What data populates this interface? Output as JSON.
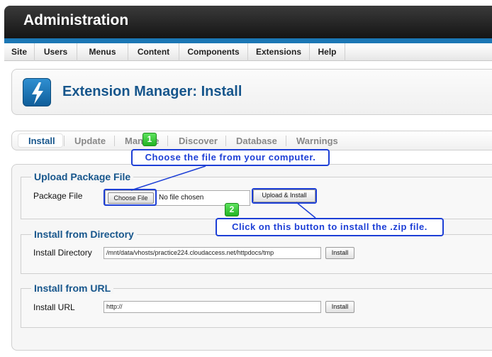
{
  "header": {
    "title": "Administration"
  },
  "menu": {
    "items": [
      {
        "label": "Site"
      },
      {
        "label": "Users"
      },
      {
        "label": "Menus"
      },
      {
        "label": "Content"
      },
      {
        "label": "Components"
      },
      {
        "label": "Extensions"
      },
      {
        "label": "Help"
      }
    ]
  },
  "page": {
    "title": "Extension Manager: Install",
    "icon": "lightning-bolt-icon"
  },
  "tabs": [
    {
      "label": "Install",
      "active": true
    },
    {
      "label": "Update"
    },
    {
      "label": "Manage"
    },
    {
      "label": "Discover"
    },
    {
      "label": "Database"
    },
    {
      "label": "Warnings"
    }
  ],
  "upload": {
    "legend": "Upload Package File",
    "field_label": "Package File",
    "choose_label": "Choose File",
    "no_file_text": "No file chosen",
    "button_label": "Upload & Install"
  },
  "directory": {
    "legend": "Install from Directory",
    "field_label": "Install Directory",
    "value": "/mnt/data/vhosts/practice224.cloudaccess.net/httpdocs/tmp",
    "button_label": "Install"
  },
  "url": {
    "legend": "Install from URL",
    "field_label": "Install URL",
    "value": "http://",
    "button_label": "Install"
  },
  "annotations": [
    {
      "number": "1",
      "text": "Choose the file from your computer."
    },
    {
      "number": "2",
      "text": "Click on this button to install the .zip file."
    }
  ],
  "colors": {
    "accent": "#17568c",
    "callout": "#1d3fd6",
    "badge": "#23b323",
    "header": "#151515"
  }
}
